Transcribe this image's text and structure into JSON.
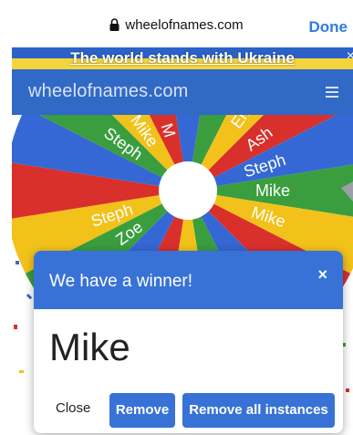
{
  "browser": {
    "url": "wheelofnames.com",
    "done_label": "Done"
  },
  "banner": {
    "text": "The world stands with Ukraine",
    "close": "×"
  },
  "site": {
    "title": "wheelofnames.com"
  },
  "wheel": {
    "labels": [
      "Mike",
      "Mike",
      "Steph",
      "Ash",
      "Emi",
      "M",
      "Mike",
      "Steph",
      "Steph",
      "Zoe"
    ],
    "colors": {
      "green": "#3a9e3f",
      "yellow": "#f2c21b",
      "red": "#d9302c",
      "blue": "#3568d4"
    }
  },
  "modal": {
    "title": "We have a winner!",
    "close_icon": "×",
    "winner": "Mike",
    "close_label": "Close",
    "remove_label": "Remove",
    "remove_all_label": "Remove all instances"
  }
}
